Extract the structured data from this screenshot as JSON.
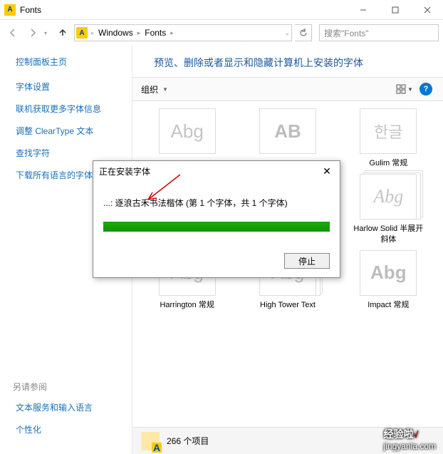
{
  "window": {
    "title": "Fonts"
  },
  "nav": {
    "breadcrumbs": [
      "Windows",
      "Fonts"
    ],
    "sep_prefix": "«",
    "search_placeholder": "搜索\"Fonts\""
  },
  "sidebar": {
    "home": "控制面板主页",
    "links": [
      "字体设置",
      "联机获取更多字体信息",
      "调整 ClearType 文本",
      "查找字符",
      "下载所有语言的字体"
    ],
    "see_also_title": "另请参阅",
    "see_also": [
      "文本服务和输入语言",
      "个性化"
    ]
  },
  "main": {
    "header": "预览、删除或者显示和隐藏计算机上安装的字体",
    "organize_label": "组织",
    "help_glyph": "?",
    "fonts": [
      {
        "sample": "Abg",
        "label": "",
        "cls": ""
      },
      {
        "sample": "AB",
        "label": "",
        "cls": "bold"
      },
      {
        "sample": "한글",
        "label": "Gulim 常规",
        "cls": "han"
      },
      {
        "sample": "Abg",
        "label": "Harlow Solid 半展开 斜体",
        "cls": "script",
        "stack": true
      },
      {
        "sample": "Abg",
        "label": "Harrington 常规",
        "cls": ""
      },
      {
        "sample": "Abg",
        "label": "High Tower Text",
        "cls": "",
        "stack": true
      },
      {
        "sample": "Abg",
        "label": "Impact 常规",
        "cls": "bold"
      }
    ],
    "status_count": "266 个项目"
  },
  "dialog": {
    "title": "正在安装字体",
    "message": "...: 逐浪古禾书法楷体 (第 1 个字体，共 1 个字体)",
    "progress_percent": 100,
    "stop_label": "停止"
  },
  "watermark": {
    "brand": "经验啦",
    "check": "√",
    "url": "jingyanla.com"
  }
}
